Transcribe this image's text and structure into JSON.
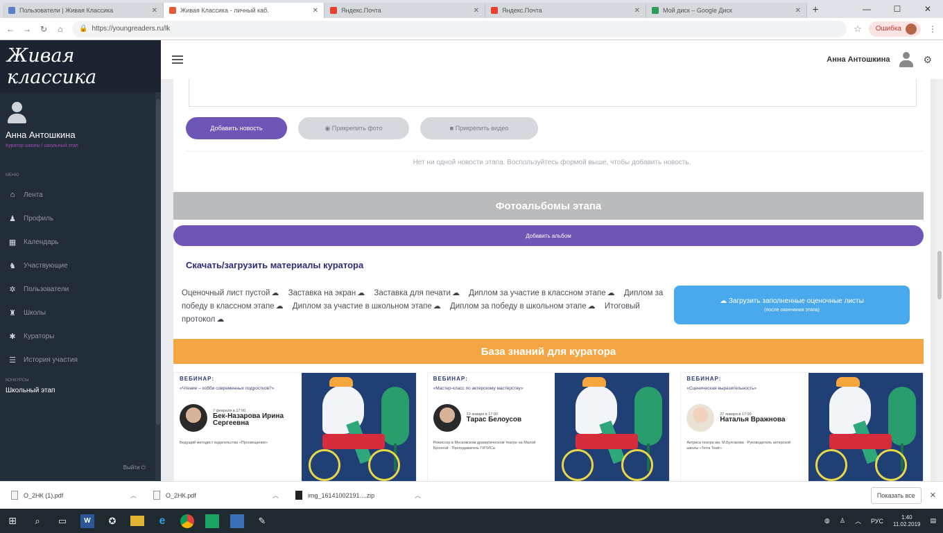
{
  "browser": {
    "tabs": [
      {
        "title": "Пользователи | Живая Классика",
        "favicon_color": "#5b7fc7",
        "active": false
      },
      {
        "title": "Живая Классика - личный каб.",
        "favicon_color": "#e25d33",
        "active": true
      },
      {
        "title": "Яндекс.Почта",
        "favicon_color": "#e8402f",
        "active": false
      },
      {
        "title": "Яндекс.Почта",
        "favicon_color": "#e8402f",
        "active": false
      },
      {
        "title": "Мой диск – Google Диск",
        "favicon_color": "#2e9a58",
        "active": false
      }
    ],
    "new_tab": "+",
    "url": "https://youngreaders.ru/lk",
    "error_label": "Ошибка"
  },
  "sidebar": {
    "logo": "Живая классика",
    "user_name": "Анна Антошкина",
    "user_role": "Куратор школы / школьный этап",
    "menu_label": "МЕНЮ",
    "items": [
      {
        "label": "Лента",
        "icon": "home-icon"
      },
      {
        "label": "Профиль",
        "icon": "user-icon"
      },
      {
        "label": "Календарь",
        "icon": "calendar-icon"
      },
      {
        "label": "Участвующие",
        "icon": "users-icon"
      },
      {
        "label": "Пользователи",
        "icon": "group-icon"
      },
      {
        "label": "Школы",
        "icon": "school-icon"
      },
      {
        "label": "Кураторы",
        "icon": "curators-icon"
      },
      {
        "label": "История участия",
        "icon": "list-icon"
      }
    ],
    "contests_label": "КОНКУРСЫ",
    "stage": "Школьный этап",
    "logout": "Выйти"
  },
  "topbar": {
    "user_name": "Анна Антошкина"
  },
  "news": {
    "add_news": "Добавить новость",
    "attach_photo": "Прикрепить фото",
    "attach_video": "Прикрепить видео",
    "empty": "Нет ни одной новости этапа. Воспользуйтесь формой выше, чтобы добавить новость."
  },
  "albums": {
    "title": "Фотоальбомы этапа",
    "add_album": "Добавить альбом"
  },
  "curator": {
    "title": "Скачать/загрузить материалы куратора",
    "links": [
      "Оценочный лист пустой",
      "Заставка на экран",
      "Заставка для печати",
      "Диплом за участие в классном этапе",
      "Диплом за победу в классном этапе",
      "Диплом за участие в школьном этапе",
      "Диплом за победу в школьном этапе",
      "Итоговый протокол"
    ],
    "upload_line1": "Загрузить заполненные оценочные листы",
    "upload_line2": "(после окончания этапа)"
  },
  "knowledge": {
    "title": "База знаний для куратора",
    "cards": [
      {
        "head": "ВЕБИНАР:",
        "topic": "«Чтение – хобби современных подростков?»",
        "date": "7 февраля в 17:00",
        "name": "Бек-Назарова Ирина Сергеевна",
        "foot": "Ведущий методист издательства «Просвещение»"
      },
      {
        "head": "ВЕБИНАР:",
        "topic": "«Мастер-класс по актерскому мастерству»",
        "date": "23 января в 17:00",
        "name": "Тарас Белоусов",
        "foot": "Режиссер в Московском драматическом театре на Малой Бронной · Преподаватель ГИТИСа"
      },
      {
        "head": "ВЕБИНАР:",
        "topic": "«Сценическая выразительность»",
        "date": "27 января в 17:00",
        "name": "Наталья Вражнова",
        "foot": "Актриса театра им. М.Булгакова · Руководитель актерской школы «Terra Teatr»"
      }
    ]
  },
  "downloads": {
    "files": [
      "О_2НК (1).pdf",
      "О_2НК.pdf",
      "img_16141002191....zip"
    ],
    "show_all": "Показать все"
  },
  "taskbar": {
    "lang": "РУС",
    "time": "1:40",
    "date": "11.02.2019"
  }
}
